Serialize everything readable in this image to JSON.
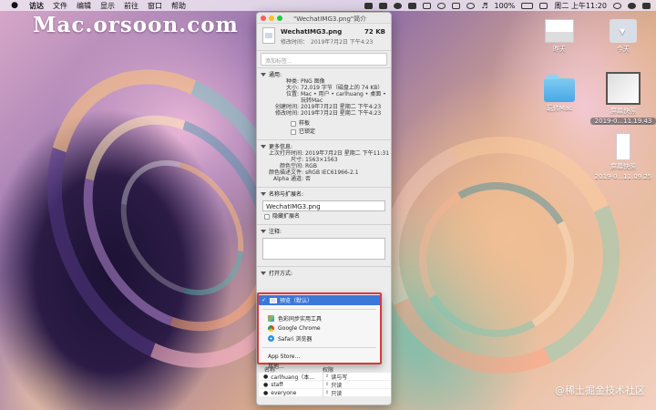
{
  "menubar": {
    "apple": "",
    "items": [
      "访达",
      "文件",
      "编辑",
      "显示",
      "前往",
      "窗口",
      "帮助"
    ],
    "battery": "100%",
    "datetime": "周二 上午11:20"
  },
  "watermark": "Mac.orsoon.com",
  "site_credit": "@稀土掘金技术社区",
  "desktop_icons": [
    {
      "label": "昨天"
    },
    {
      "label": "今天"
    },
    {
      "label": "玩转Mac"
    },
    {
      "label": "屏幕快照",
      "sub": "2019-0...11.19.43"
    },
    {
      "label": "屏幕快照",
      "sub": "2019-0...11.09.25"
    }
  ],
  "window": {
    "title": "\"WechatIMG3.png\"简介",
    "filename": "WechatIMG3.png",
    "size": "72 KB",
    "modified_label": "修改时间：",
    "modified_value": "2019年7月2日 下午4:23",
    "tags_placeholder": "添加标签...",
    "general": {
      "title": "通用:",
      "rows": [
        {
          "k": "种类:",
          "v": "PNG 图像"
        },
        {
          "k": "大小:",
          "v": "72,019 字节（磁盘上的 74 KB）"
        },
        {
          "k": "位置:",
          "v": "Mac • 用户 • carlhuang • 桌面 •"
        },
        {
          "k": "",
          "v": "玩转Mac"
        },
        {
          "k": "创建时间:",
          "v": "2019年7月2日 星期二 下午4:23"
        },
        {
          "k": "修改时间:",
          "v": "2019年7月2日 星期二 下午4:23"
        }
      ],
      "stationery": "样板",
      "locked": "已锁定"
    },
    "more": {
      "title": "更多信息:",
      "rows": [
        {
          "k": "上次打开时间:",
          "v": "2019年7月2日 星期二 下午11:31"
        },
        {
          "k": "尺寸:",
          "v": "1563×1563"
        },
        {
          "k": "颜色空间:",
          "v": "RGB"
        },
        {
          "k": "颜色描述文件:",
          "v": "sRGB IEC61966-2.1"
        },
        {
          "k": "Alpha 通道:",
          "v": "否"
        }
      ]
    },
    "name_ext": {
      "title": "名称与扩展名:",
      "value": "WechatIMG3.png",
      "hide_ext": "隐藏扩展名"
    },
    "comments": {
      "title": "注释:"
    },
    "open_with": {
      "title": "打开方式:"
    },
    "permissions": {
      "col_name": "名称",
      "col_priv": "权限",
      "rows": [
        {
          "name": "carlhuang（本...",
          "priv": "读与写"
        },
        {
          "name": "staff",
          "priv": "只读"
        },
        {
          "name": "everyone",
          "priv": "只读"
        }
      ]
    }
  },
  "dropdown": {
    "selected": "预览（默认）",
    "apps": [
      "色彩同步实用工具",
      "Google Chrome",
      "Safari 浏览器"
    ],
    "app_store": "App Store...",
    "other": "其他..."
  },
  "colors": {
    "selection": "#3a78d8",
    "highlight_box": "#d63a3a",
    "close": "#fd5f57",
    "minimize": "#febb2e",
    "zoom": "#28c840"
  }
}
